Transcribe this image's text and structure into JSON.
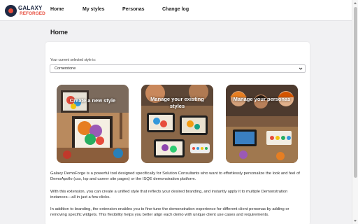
{
  "brand": {
    "line1": "GALAXY",
    "line2": "REFORGED"
  },
  "nav": {
    "items": [
      {
        "label": "Home"
      },
      {
        "label": "My styles"
      },
      {
        "label": "Personas"
      },
      {
        "label": "Change log"
      }
    ]
  },
  "page": {
    "title": "Home"
  },
  "style_picker": {
    "label": "Your current selected style is:",
    "selected": "Cornerstone"
  },
  "tiles": [
    {
      "label": "Create a new style"
    },
    {
      "label": "Manage your existing styles"
    },
    {
      "label": "Manage your personas"
    }
  ],
  "description": [
    "Galaxy DemoForge is a powerful tool designed specifically for Solution Consultants who want to effortlessly personalize the look and feel of DemoApollo (csx, lxp and career site pages) or the ISQE demonstration platform.",
    "With this extension, you can create a unified style that reflects your desired branding, and instantly apply it to multiple Demonstration instances—all in just a few clicks.",
    "In addition to branding, the extension enables you to fine-tune the demonstration experience for different client personas by adding or removing specific widgets. This flexibility helps you better align each demo with unique client use cases and requirements."
  ],
  "colors": {
    "accent": "#e74c3c",
    "brand_dark": "#1f2a44"
  }
}
